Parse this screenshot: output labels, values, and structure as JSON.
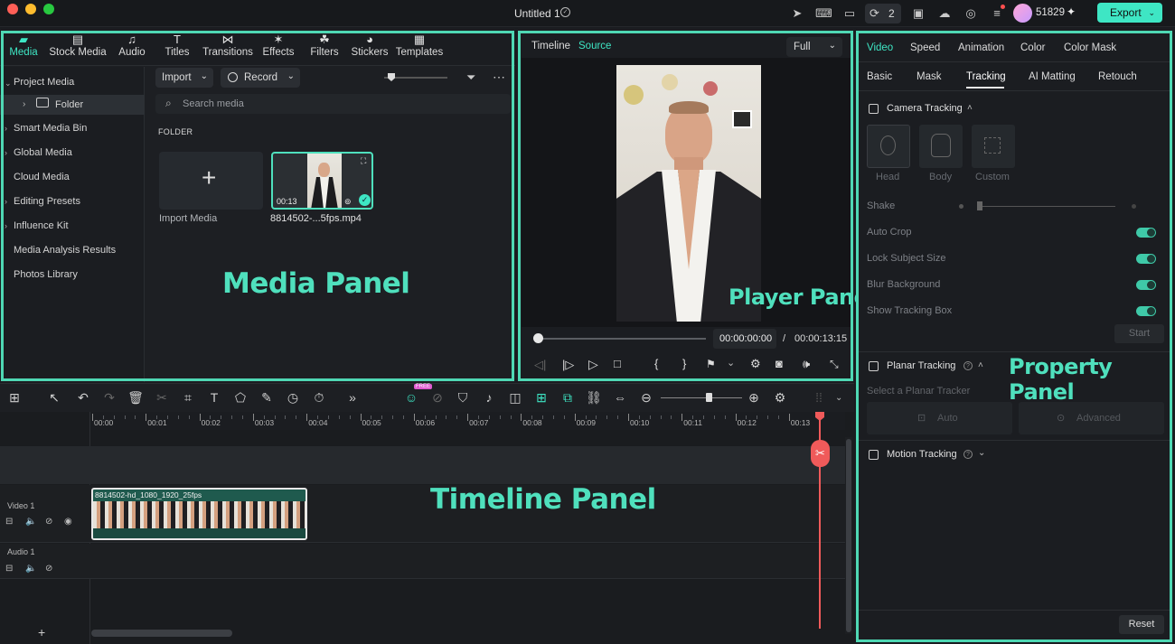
{
  "window": {
    "title": "Untitled 1"
  },
  "top": {
    "badge_count": "2",
    "credits": "51829",
    "export_label": "Export"
  },
  "media_tabs": [
    {
      "label": "Media",
      "icon": "media-icon",
      "active": true
    },
    {
      "label": "Stock Media",
      "icon": "stock-media-icon"
    },
    {
      "label": "Audio",
      "icon": "music-note-icon"
    },
    {
      "label": "Titles",
      "icon": "titles-icon"
    },
    {
      "label": "Transitions",
      "icon": "transitions-icon"
    },
    {
      "label": "Effects",
      "icon": "effects-icon"
    },
    {
      "label": "Filters",
      "icon": "filters-icon"
    },
    {
      "label": "Stickers",
      "icon": "stickers-icon"
    },
    {
      "label": "Templates",
      "icon": "templates-icon"
    }
  ],
  "sidebar": {
    "items": [
      {
        "label": "Project Media"
      },
      {
        "label": "Folder"
      },
      {
        "label": "Smart Media Bin"
      },
      {
        "label": "Global Media"
      },
      {
        "label": "Cloud Media"
      },
      {
        "label": "Editing Presets"
      },
      {
        "label": "Influence Kit"
      },
      {
        "label": "Media Analysis Results"
      },
      {
        "label": "Photos Library"
      }
    ]
  },
  "media": {
    "import_label": "Import",
    "record_label": "Record",
    "search_placeholder": "Search media",
    "folder_heading": "FOLDER",
    "import_media_label": "Import Media",
    "clip_duration": "00:13",
    "clip_name": "8814502-...5fps.mp4"
  },
  "annotations": {
    "media_panel": "Media Panel",
    "player_panel": "Player Panel",
    "property_panel": "Property Panel",
    "timeline_panel": "Timeline Panel"
  },
  "player": {
    "tab_timeline": "Timeline",
    "tab_source": "Source",
    "quality": "Full",
    "current_time": "00:00:00:00",
    "separator": "/",
    "total_time": "00:00:13:15"
  },
  "property": {
    "tabs": [
      "Video",
      "Speed",
      "Animation",
      "Color",
      "Color Mask"
    ],
    "subtabs": [
      "Basic",
      "Mask",
      "Tracking",
      "AI Matting",
      "Retouch"
    ],
    "camera_tracking": "Camera Tracking",
    "targets": [
      "Head",
      "Body",
      "Custom"
    ],
    "shake": "Shake",
    "auto_crop": "Auto Crop",
    "lock_subject": "Lock Subject Size",
    "blur_bg": "Blur Background",
    "show_box": "Show Tracking Box",
    "start": "Start",
    "planar_tracking": "Planar Tracking",
    "select_tracker": "Select a Planar Tracker",
    "auto": "Auto",
    "advanced": "Advanced",
    "motion_tracking": "Motion Tracking",
    "reset": "Reset"
  },
  "timeline": {
    "free_badge": "FREE",
    "ruler": [
      "00:00",
      "00:01",
      "00:02",
      "00:03",
      "00:04",
      "00:05",
      "00:06",
      "00:07",
      "00:08",
      "00:09",
      "00:10",
      "00:11",
      "00:12",
      "00:13"
    ],
    "video_track": "Video 1",
    "audio_track": "Audio 1",
    "clip_label": "8814502-hd_1080_1920_25fps"
  },
  "colors": {
    "accent": "#3ee6c4",
    "frame": "#4fd8b4",
    "playhead": "#f05a5a"
  }
}
